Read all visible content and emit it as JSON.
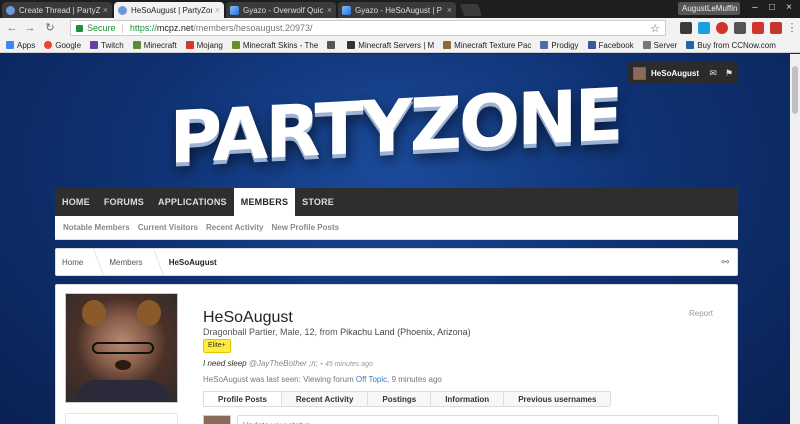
{
  "browser": {
    "tabs": [
      {
        "title": "Create Thread | PartyZone",
        "icon": "globe-icon",
        "active": false
      },
      {
        "title": "HeSoAugust | PartyZone",
        "icon": "globe-icon",
        "active": true
      },
      {
        "title": "Gyazo - Overwolf Quick",
        "icon": "gyazo-icon",
        "active": false
      },
      {
        "title": "Gyazo - HeSoAugust | P",
        "icon": "gyazo-icon",
        "active": false
      }
    ],
    "profile_chip": "AugustLeMuffin",
    "address": {
      "secure_label": "Secure",
      "scheme": "https://",
      "host": "mcpz.net",
      "path": "/members/hesoaugust.20973/"
    },
    "bookmarks": [
      {
        "label": "Apps",
        "color": "#4285f4"
      },
      {
        "label": "Google",
        "color": "#ea4335"
      },
      {
        "label": "Twitch",
        "color": "#6441a5"
      },
      {
        "label": "Minecraft",
        "color": "#5b8c32"
      },
      {
        "label": "Mojang",
        "color": "#d03a2f"
      },
      {
        "label": "Minecraft Skins - The",
        "color": "#6b8e23"
      },
      {
        "label": "",
        "color": "#555555"
      },
      {
        "label": "Minecraft Servers | M",
        "color": "#333333"
      },
      {
        "label": "Minecraft Texture Pac",
        "color": "#8b6b3a"
      },
      {
        "label": "Prodigy",
        "color": "#4a6fa5"
      },
      {
        "label": "Facebook",
        "color": "#3b5998"
      },
      {
        "label": "Server",
        "color": "#777777"
      },
      {
        "label": "Buy from CCNow.com",
        "color": "#2266aa"
      }
    ]
  },
  "header": {
    "logo_text": "PARTYZONE",
    "user_name": "HeSoAugust"
  },
  "nav": {
    "items": [
      {
        "label": "HOME",
        "active": false
      },
      {
        "label": "FORUMS",
        "active": false
      },
      {
        "label": "APPLICATIONS",
        "active": false
      },
      {
        "label": "MEMBERS",
        "active": true
      },
      {
        "label": "STORE",
        "active": false
      }
    ],
    "sub_items": [
      "Notable Members",
      "Current Visitors",
      "Recent Activity",
      "New Profile Posts"
    ]
  },
  "breadcrumb": [
    "Home",
    "Members",
    "HeSoAugust"
  ],
  "profile": {
    "username": "HeSoAugust",
    "report": "Report",
    "blurb_prefix": "Dragonball Partier, Male, 12, ",
    "blurb_from": "from",
    "location": "Pikachu Land (Phoenix, Arizona)",
    "usergroup": "Elite+",
    "status_text": "I need sleep",
    "status_mention": "@JayTheBother ;n;",
    "status_time": "45 minutes ago",
    "last_seen_prefix": "HeSoAugust was last seen:",
    "last_seen_action": "Viewing forum",
    "last_seen_forum": "Off Topic",
    "last_seen_time": ", 9 minutes ago",
    "tabs": [
      "Profile Posts",
      "Recent Activity",
      "Postings",
      "Information",
      "Previous usernames"
    ],
    "status_placeholder": "Update your status..."
  }
}
